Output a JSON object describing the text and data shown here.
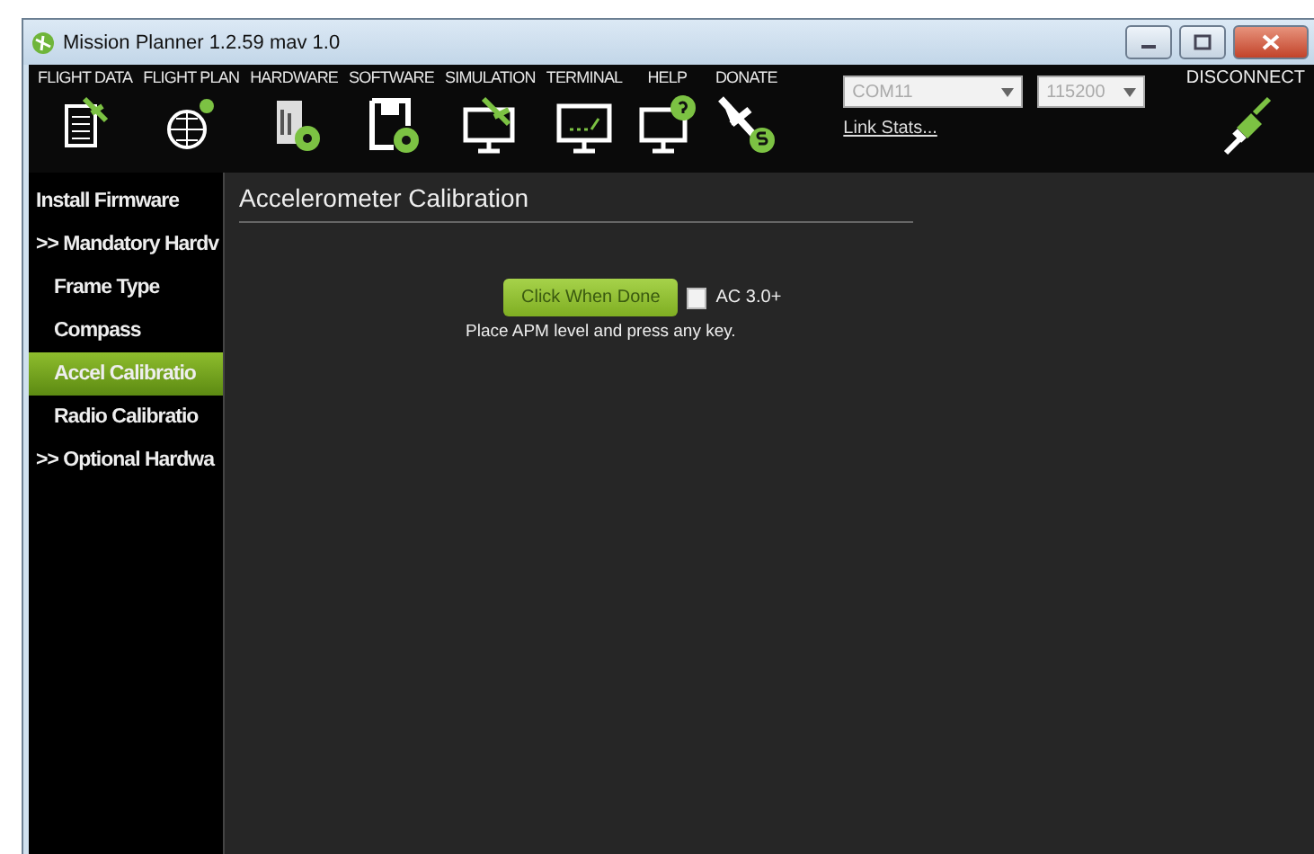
{
  "window": {
    "title": "Mission Planner 1.2.59 mav 1.0"
  },
  "menu": [
    {
      "label": "FLIGHT DATA"
    },
    {
      "label": "FLIGHT PLAN"
    },
    {
      "label": "HARDWARE"
    },
    {
      "label": "SOFTWARE"
    },
    {
      "label": "SIMULATION"
    },
    {
      "label": "TERMINAL"
    },
    {
      "label": "HELP"
    },
    {
      "label": "DONATE"
    }
  ],
  "connection": {
    "port": "COM11",
    "baud": "115200",
    "link": "Link Stats...",
    "button": "DISCONNECT"
  },
  "sidebar": [
    {
      "label": "Install Firmware",
      "selected": false
    },
    {
      "label": ">> Mandatory Hardv",
      "selected": false,
      "children": [
        {
          "label": "Frame Type",
          "selected": false
        },
        {
          "label": "Compass",
          "selected": false
        },
        {
          "label": "Accel Calibratio",
          "selected": true
        },
        {
          "label": "Radio Calibratio",
          "selected": false
        }
      ]
    },
    {
      "label": ">> Optional Hardwa",
      "selected": false
    }
  ],
  "panel": {
    "title": "Accelerometer Calibration",
    "button": "Click When Done",
    "checkbox": {
      "label": "AC 3.0+",
      "checked": false
    },
    "message": "Place APM level and press any key."
  }
}
